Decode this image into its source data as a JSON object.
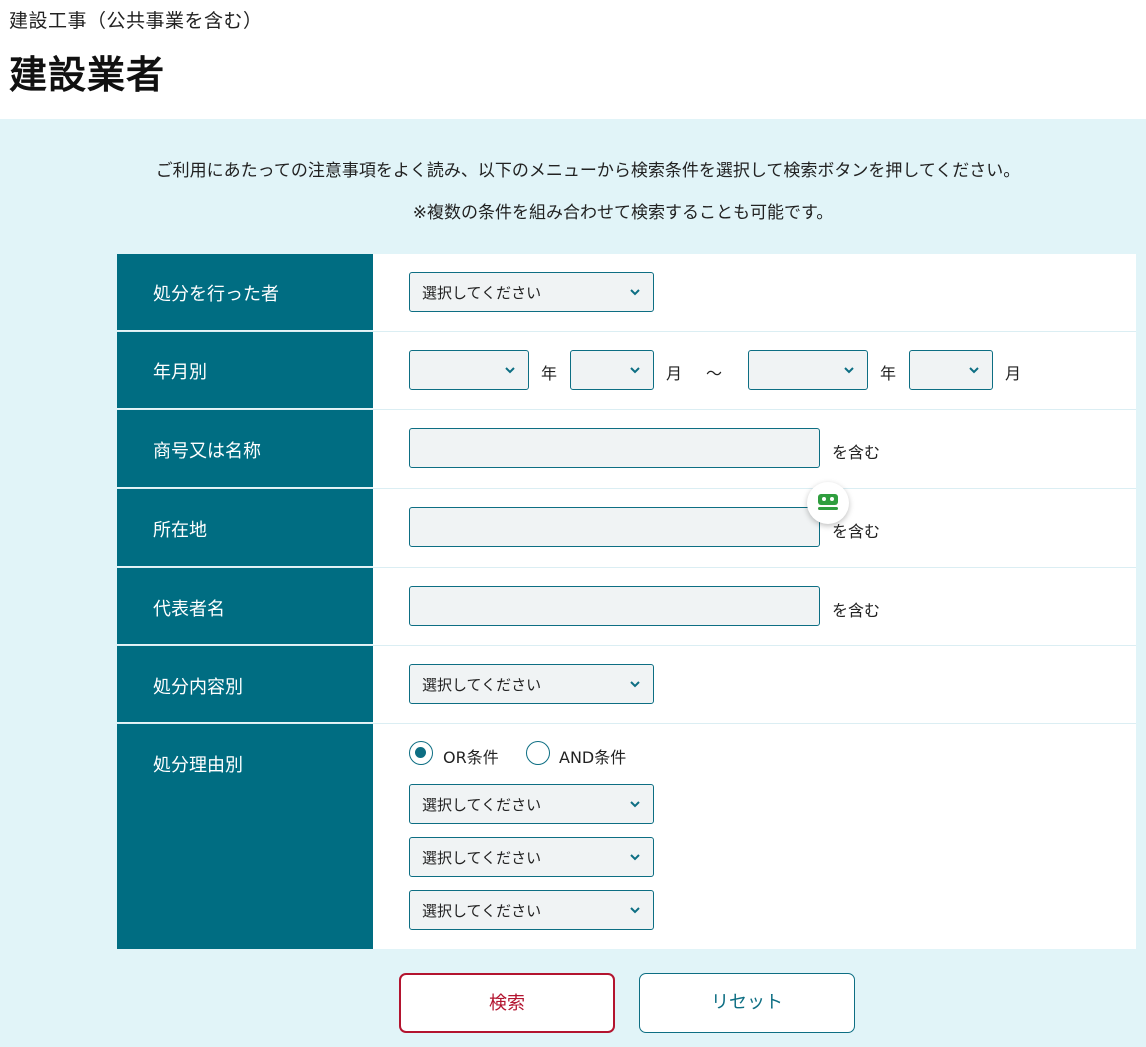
{
  "header": {
    "subtitle": "建設工事（公共事業を含む）",
    "title": "建設業者"
  },
  "intro": {
    "line1": "ご利用にあたっての注意事項をよく読み、以下のメニューから検索条件を選択して検索ボタンを押してください。",
    "line2": "※複数の条件を組み合わせて検索することも可能です。"
  },
  "form": {
    "rows": [
      {
        "label": "処分を行った者",
        "select_value": "選択してください"
      },
      {
        "label": "年月別",
        "year_unit": "年",
        "month_unit": "月",
        "range_sep": "～",
        "year_unit_2": "年",
        "month_unit_2": "月"
      },
      {
        "label": "商号又は名称",
        "suffix": "を含む"
      },
      {
        "label": "所在地",
        "suffix": "を含む"
      },
      {
        "label": "代表者名",
        "suffix": "を含む"
      },
      {
        "label": "処分内容別",
        "select_value": "選択してください"
      },
      {
        "label": "処分理由別",
        "radio_or": "OR条件",
        "radio_and": "AND条件",
        "selected_radio": "OR条件",
        "selects": [
          "選択してください",
          "選択してください",
          "選択してください"
        ]
      }
    ]
  },
  "buttons": {
    "search": "検索",
    "reset": "リセット"
  },
  "colors": {
    "label_bg": "#006d82",
    "panel_bg": "#e1f4f8",
    "search_border": "#b3142f",
    "accent": "#0d6e83"
  }
}
